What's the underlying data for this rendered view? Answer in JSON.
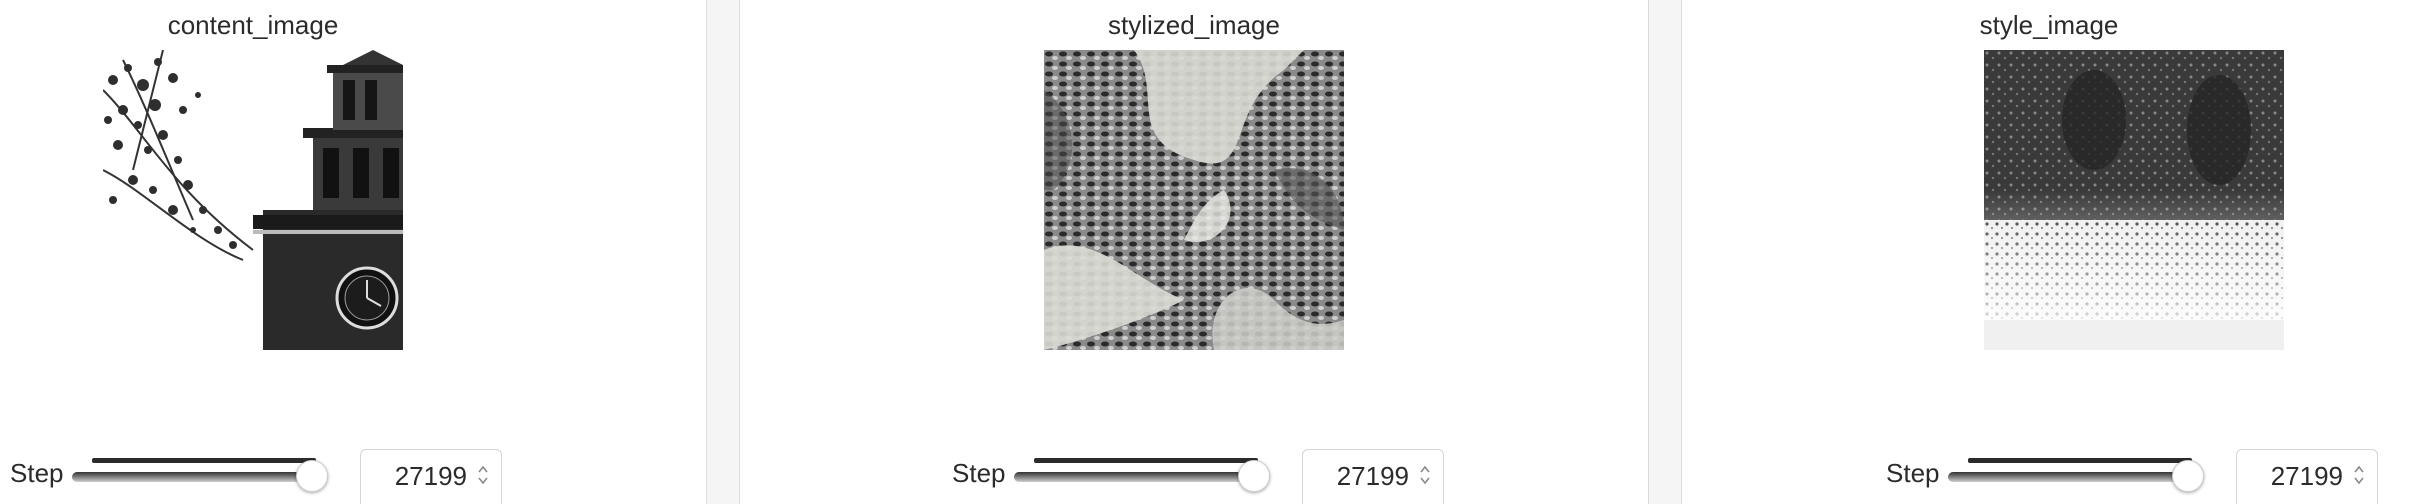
{
  "panels": [
    {
      "title": "content_image",
      "step_label": "Step",
      "step_value": "27199",
      "slider_fraction": 1.0
    },
    {
      "title": "stylized_image",
      "step_label": "Step",
      "step_value": "27199",
      "slider_fraction": 1.0
    },
    {
      "title": "style_image",
      "step_label": "Step",
      "step_value": "27199",
      "slider_fraction": 1.0
    }
  ],
  "colors": {
    "gutter": "#f5f5f6",
    "text": "#2b2b2b"
  },
  "icons": {
    "spinner": "chevron-up-down-icon"
  }
}
